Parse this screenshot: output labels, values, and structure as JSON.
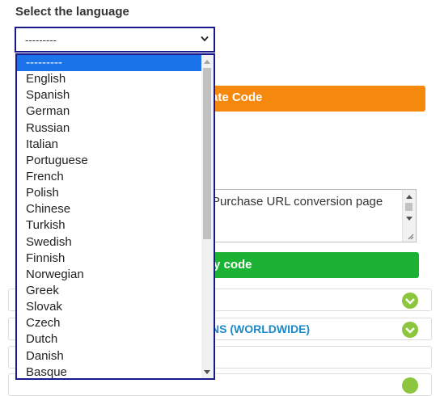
{
  "heading": "Select the language",
  "select": {
    "value": "---------"
  },
  "generate_button": {
    "label": "ate Code"
  },
  "textarea": {
    "value": "Purchase URL conversion page"
  },
  "copy_button": {
    "label": "y code"
  },
  "accordion": [
    {
      "label": ""
    },
    {
      "label": "NS (WORLDWIDE)"
    },
    {
      "label": ""
    }
  ],
  "dropdown": {
    "options": [
      "---------",
      "English",
      "Spanish",
      "German",
      "Russian",
      "Italian",
      "Portuguese",
      "French",
      "Polish",
      "Chinese",
      "Turkish",
      "Swedish",
      "Finnish",
      "Norwegian",
      "Greek",
      "Slovak",
      "Czech",
      "Dutch",
      "Danish",
      "Basque"
    ],
    "selected_index": 0
  },
  "colors": {
    "focus_border": "#1a1a8c",
    "selected_bg": "#1a73e8",
    "generate_btn": "#f5890e",
    "copy_btn": "#1cb335",
    "accordion_link": "#1d89c9",
    "check_badge": "#8cc63e"
  },
  "icons": {
    "select_arrow": "chevron-down-icon",
    "accordion_status": "check-circle-icon"
  }
}
